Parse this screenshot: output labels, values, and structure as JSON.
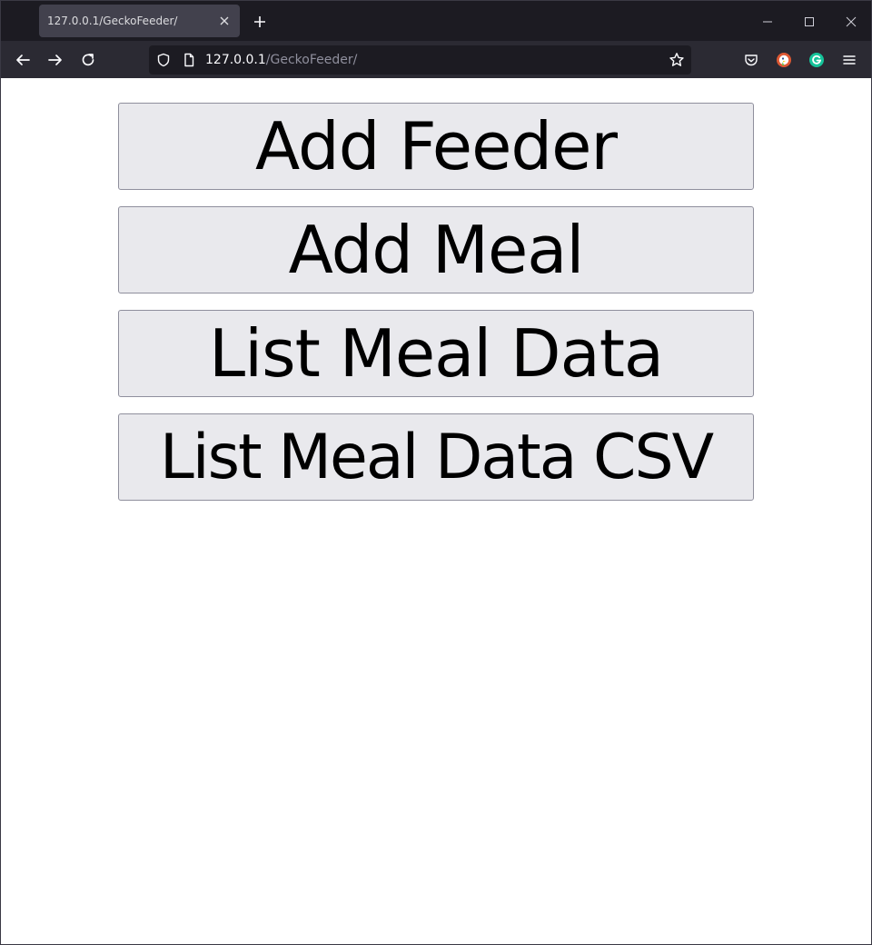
{
  "browser": {
    "tab_title": "127.0.0.1/GeckoFeeder/",
    "url_host": "127.0.0.1",
    "url_path": "/GeckoFeeder/",
    "colors": {
      "frame": "#1c1b22",
      "toolbar": "#2b2a33",
      "tab_active": "#42414d",
      "duckduckgo": "#de5833",
      "grammarly": "#15c39a"
    },
    "icons": [
      "back-icon",
      "forward-icon",
      "reload-icon",
      "shield-icon",
      "page-icon",
      "star-icon",
      "pocket-icon",
      "duckduckgo-icon",
      "grammarly-icon",
      "menu-icon"
    ]
  },
  "page": {
    "buttons": [
      {
        "label": "Add Feeder"
      },
      {
        "label": "Add Meal"
      },
      {
        "label": "List Meal Data"
      },
      {
        "label": "List Meal Data CSV"
      }
    ],
    "colors": {
      "button_bg": "#e9e9ed",
      "button_border": "#8f8f9d",
      "background": "#ffffff"
    }
  }
}
